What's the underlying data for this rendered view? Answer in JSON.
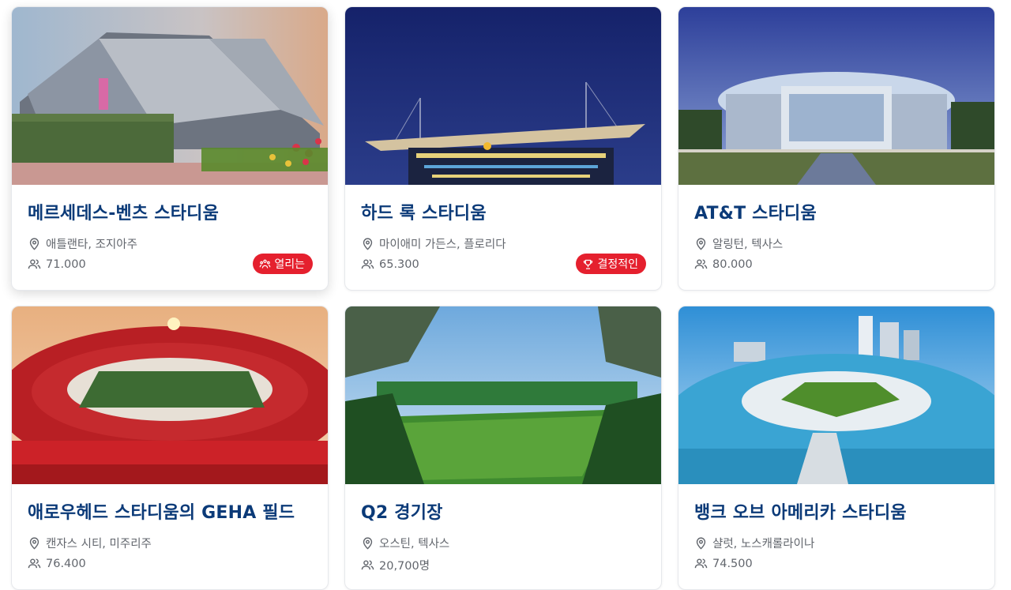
{
  "cards": [
    {
      "title": "메르세데스-벤츠 스타디움",
      "location": "애틀랜타, 조지아주",
      "capacity": "71.000",
      "badge": "열리는",
      "badge_icon": "stage-icon"
    },
    {
      "title": "하드 록 스타디움",
      "location": "마이애미 가든스, 플로리다",
      "capacity": "65.300",
      "badge": "결정적인",
      "badge_icon": "trophy-icon"
    },
    {
      "title": "AT&T 스타디움",
      "location": "알링턴, 텍사스",
      "capacity": "80.000"
    },
    {
      "title": "애로우헤드 스타디움의 GEHA 필드",
      "location": "캔자스 시티, 미주리주",
      "capacity": "76.400"
    },
    {
      "title": "Q2 경기장",
      "location": "오스틴, 텍사스",
      "capacity": "20,700명"
    },
    {
      "title": "뱅크 오브 아메리카 스타디움",
      "location": "샬럿, 노스캐롤라이나",
      "capacity": "74.500"
    }
  ],
  "colors": {
    "title": "#0b3a78",
    "meta": "#62666d",
    "badge": "#e5202e"
  },
  "icons": {
    "location": "map-pin-icon",
    "capacity": "people-icon"
  }
}
